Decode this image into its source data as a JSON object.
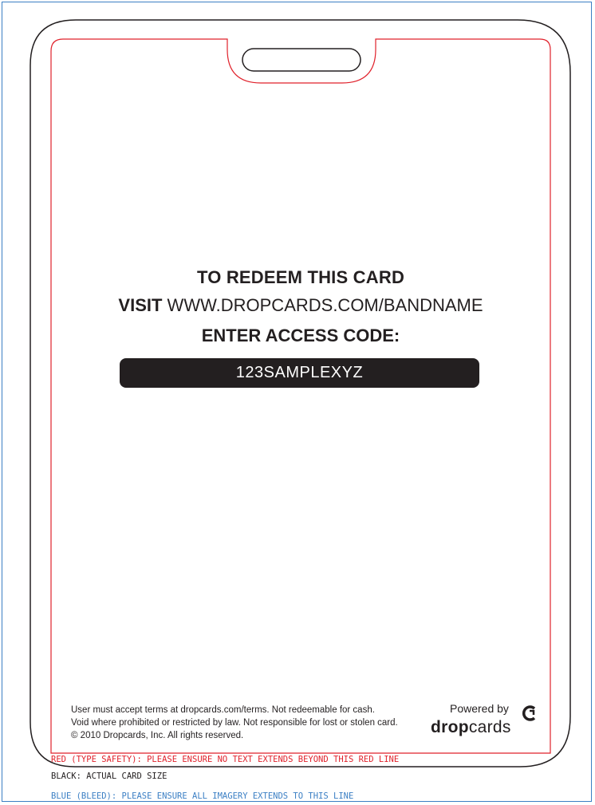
{
  "card": {
    "line1": "TO REDEEM THIS CARD",
    "line2_prefix": "VISIT",
    "line2_url": " WWW.DROPCARDS.COM/BANDNAME",
    "line3": "ENTER ACCESS CODE:",
    "access_code": "123SAMPLEXYZ"
  },
  "legal": {
    "line1": "User must accept terms at dropcards.com/terms. Not redeemable for cash.",
    "line2": "Void where prohibited or restricted by law. Not responsible for lost or stolen card.",
    "line3": "© 2010 Dropcards, Inc. All rights reserved."
  },
  "branding": {
    "powered_by": "Powered by",
    "logo_bold": "drop",
    "logo_regular": "cards",
    "logo_icon": "dropcards-mark-icon"
  },
  "guides": {
    "red": "RED (TYPE SAFETY): PLEASE ENSURE NO TEXT EXTENDS BEYOND THIS RED LINE",
    "black": "BLACK: ACTUAL CARD SIZE",
    "blue": "BLUE (BLEED): PLEASE ENSURE ALL IMAGERY EXTENDS TO THIS LINE"
  },
  "colors": {
    "safety_line": "#e0212b",
    "card_outline": "#231f20",
    "bleed_line": "#3b7fc4",
    "code_bar": "#231f20"
  }
}
